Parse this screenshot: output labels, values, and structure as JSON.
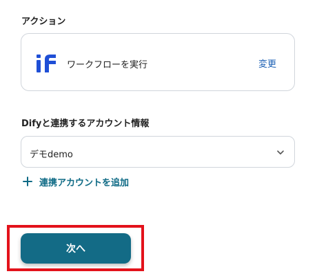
{
  "action_section": {
    "label": "アクション",
    "action_name": "ワークフローを実行",
    "change_label": "変更",
    "app_logo_text": "if"
  },
  "account_section": {
    "label": "Difyと連携するアカウント情報",
    "selected_account": "デモdemo",
    "add_account_label": "連携アカウントを追加"
  },
  "footer": {
    "next_label": "次へ"
  },
  "colors": {
    "accent": "#136b86",
    "link": "#1a5fb4",
    "logo": "#1f4fd6",
    "highlight": "#e3121b"
  }
}
